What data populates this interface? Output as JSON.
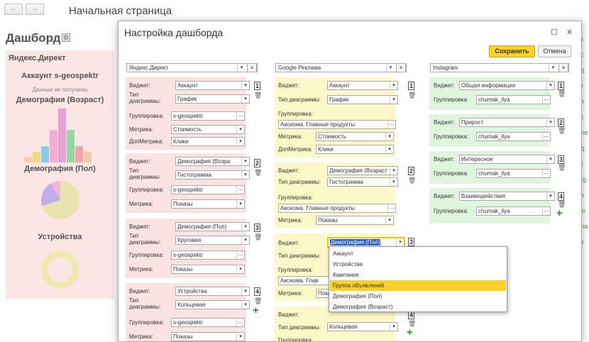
{
  "nav": {
    "back_icon": "←",
    "forward_icon": "→"
  },
  "page": {
    "title": "Начальная страница"
  },
  "dashboard": {
    "title": "Дашборд",
    "panel_title": "Яндекс.Директ",
    "account": "Аккаунт s-geospektr",
    "no_data": "Данные не получены",
    "chart1_title": "Демография (Возраст)",
    "chart2_title": "Демография (Пол)",
    "chart3_title": "Устройства",
    "bar_values": [
      1,
      2,
      3,
      6,
      10,
      6,
      3,
      2
    ],
    "bar_colors": [
      "#f2c9a0",
      "#f0d878",
      "#7cc8e8",
      "#f4a8cf",
      "#e89ad0",
      "#8ad4a0",
      "#f0a0a0",
      "#f6c3a3"
    ],
    "pie_values": [
      70,
      22,
      8
    ],
    "pie_colors": [
      "#e8e1a6",
      "#b9a6e8",
      "#f0b4d6"
    ],
    "donut_value": 100,
    "donut_color": "#eee8a8"
  },
  "bg_links": [
    "к",
    "с",
    "д",
    "т",
    "п",
    "с",
    "ле",
    "д",
    "т",
    "rg",
    "п",
    "ю",
    "ла",
    "з"
  ],
  "dialog": {
    "title": "Настройка дашборда",
    "maximize_icon": "☐",
    "close_icon": "✕",
    "save_label": "Сохранить",
    "cancel_label": "Отмена"
  },
  "labels": {
    "widget": "Виджет:",
    "chart_type_1": "Тип",
    "chart_type_2": "диаграммы:",
    "chart_type_full": "Тип диаграммы:",
    "grouping": "Группировка:",
    "metric": "Метрика:",
    "dop_metric": "ДопМетрика:",
    "dots": "...",
    "trash_icon": "🗑",
    "plus_icon": "+",
    "dropdown_icon": "▾",
    "clear_icon": "×"
  },
  "columns": [
    {
      "source": "Яндекс.Директ",
      "widgets": [
        {
          "num": "1",
          "widget": "Аккаунт",
          "type": "График",
          "group": "s-geospektr",
          "metric": "Стоимость",
          "dop": "Клики"
        },
        {
          "num": "2",
          "widget": "Демография (Возра",
          "type": "Гистограмма",
          "group": "s-geospektr",
          "metric": "Показы"
        },
        {
          "num": "3",
          "widget": "Демография (Пол)",
          "type": "Круговая",
          "group": "s-geospektr",
          "metric": "Показы"
        },
        {
          "num": "4",
          "widget": "Устройства",
          "type": "Кольцевая",
          "group": "s-geospektr",
          "metric": "Показы"
        }
      ]
    },
    {
      "source": "Google Реклама",
      "widgets": [
        {
          "num": "1",
          "widget": "Аккаунт",
          "type": "График",
          "group": "Аксиома. Главные продукты",
          "metric": "Стоимость",
          "dop": "Клики"
        },
        {
          "num": "2",
          "widget": "Демография (Возраст",
          "type": "Гистограмма",
          "group": "Аксиома. Главные продукты",
          "metric": "Показы"
        },
        {
          "num": "3",
          "widget": "Демография (Пол)",
          "group": "Аксиома. Глав",
          "metric": "Показы"
        },
        {
          "num": "4",
          "type": "Кольцевая"
        }
      ]
    },
    {
      "source": "Instagram",
      "widgets": [
        {
          "num": "1",
          "widget": "Общая информация",
          "group": "chumak_ilya"
        },
        {
          "num": "2",
          "widget": "Прирост",
          "group": "chumak_ilya"
        },
        {
          "num": "3",
          "widget": "Интересное",
          "group": "chumak_ilya"
        },
        {
          "num": "4",
          "widget": "Взаимодействия",
          "group": "chumak_ilya"
        }
      ]
    }
  ],
  "dropdown": {
    "options": [
      "Аккаунт",
      "Устройства",
      "Кампания",
      "Группа объявлений",
      "Демография (Пол)",
      "Демография (Возраст)"
    ],
    "selected_index": 3
  }
}
